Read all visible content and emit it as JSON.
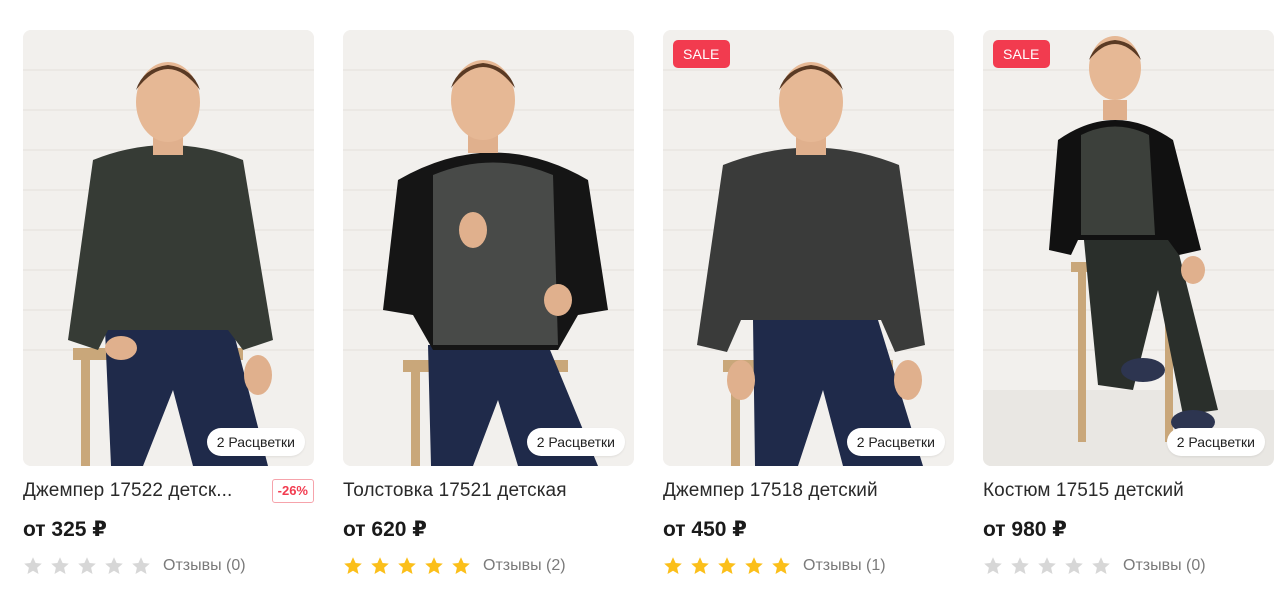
{
  "colors": {
    "star_filled": "#fbbf1a",
    "star_empty": "#d7d7d7",
    "sale_badge": "#f23b4f",
    "discount_text": "#f23b4f"
  },
  "products": [
    {
      "title": "Джемпер 17522 детск...",
      "price": "от 325 ₽",
      "discount": "-26%",
      "sale_badge": "",
      "colors_badge": "2 Расцветки",
      "rating": 0,
      "rating_max": 5,
      "reviews": "Отзывы (0)"
    },
    {
      "title": "Толстовка 17521 детская",
      "price": "от 620 ₽",
      "discount": "",
      "sale_badge": "",
      "colors_badge": "2 Расцветки",
      "rating": 5,
      "rating_max": 5,
      "reviews": "Отзывы (2)"
    },
    {
      "title": "Джемпер 17518 детский",
      "price": "от 450 ₽",
      "discount": "",
      "sale_badge": "SALE",
      "colors_badge": "2 Расцветки",
      "rating": 5,
      "rating_max": 5,
      "reviews": "Отзывы (1)"
    },
    {
      "title": "Костюм 17515 детский",
      "price": "от 980 ₽",
      "discount": "",
      "sale_badge": "SALE",
      "colors_badge": "2 Расцветки",
      "rating": 0,
      "rating_max": 5,
      "reviews": "Отзывы (0)"
    }
  ]
}
